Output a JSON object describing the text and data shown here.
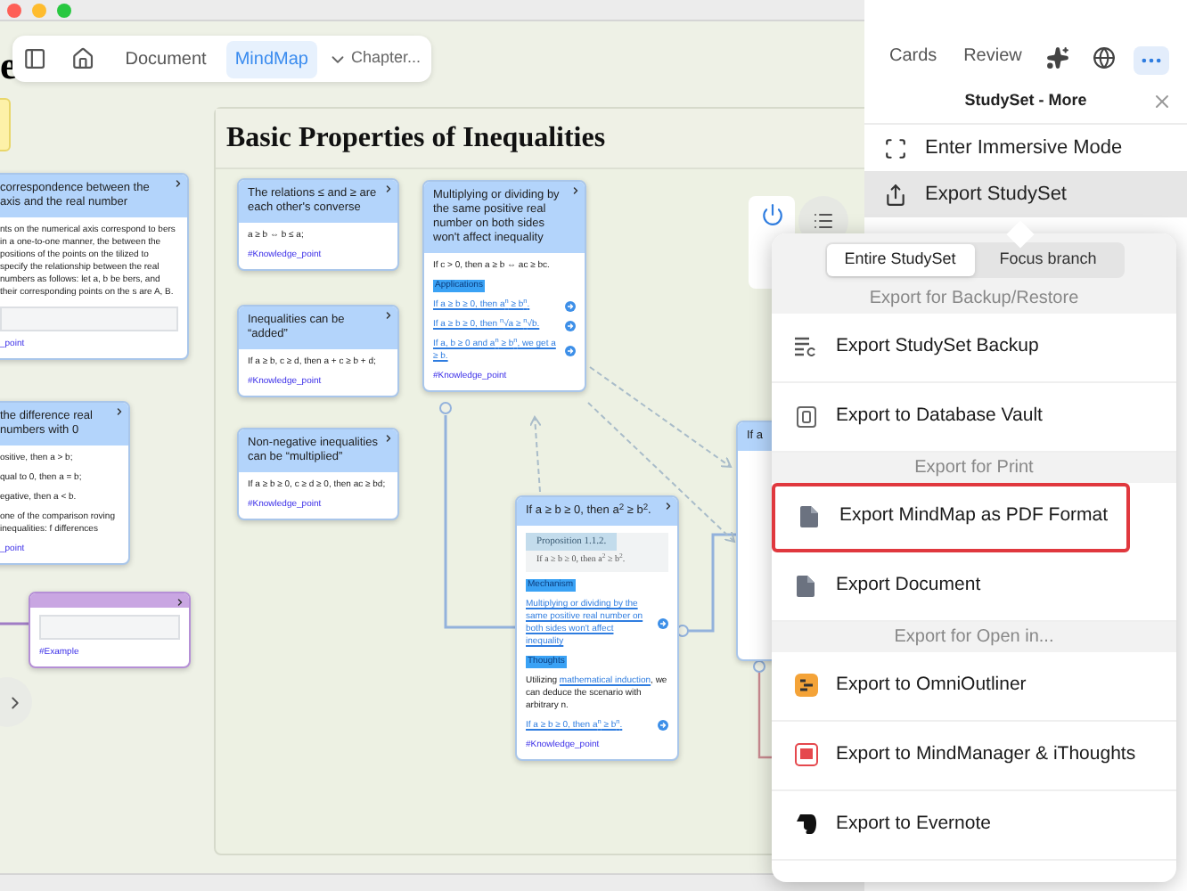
{
  "window": {
    "title_fragment": "e"
  },
  "toolbar": {
    "views": [
      {
        "label": "Document",
        "selected": false
      },
      {
        "label": "MindMap",
        "selected": true
      }
    ],
    "chapter": "Chapter..."
  },
  "canvas": {
    "frame": {
      "title": "Basic Properties of Inequalities"
    },
    "cards": [
      {
        "kind": "note",
        "color": "#fdf1a8"
      },
      {
        "kind": "topic",
        "color": "#b3d4fb",
        "header": "correspondence between the axis and the real number",
        "blocks": [
          {
            "kind": "text",
            "text": "nts on the numerical axis correspond to bers in a one-to-one manner, the between the positions of the points on the tilized to specify the relationship between the real numbers as follows: let a, b be bers, and their corresponding points on the s are A, B."
          },
          {
            "kind": "image"
          },
          {
            "kind": "tag",
            "text": "_point"
          }
        ]
      },
      {
        "kind": "topic",
        "color": "#b3d4fb",
        "header": "the difference real numbers with 0",
        "blocks": [
          {
            "kind": "text",
            "text": "ositive, then a > b;"
          },
          {
            "kind": "text",
            "text": "qual to 0, then a = b;"
          },
          {
            "kind": "text",
            "text": "egative, then a < b."
          },
          {
            "kind": "text",
            "text": "one of the comparison roving inequalities: f differences"
          },
          {
            "kind": "tag",
            "text": "_point"
          }
        ]
      },
      {
        "kind": "example",
        "color": "#c9a6e2",
        "blocks": [
          {
            "kind": "image"
          },
          {
            "kind": "tag",
            "text": "#Example"
          }
        ]
      },
      {
        "kind": "topic",
        "color": "#b3d4fb",
        "header": "The relations ≤ and ≥ are each other's converse",
        "blocks": [
          {
            "kind": "text",
            "text": "a ≥ b ⇔ b ≤ a;"
          },
          {
            "kind": "tag",
            "text": "#Knowledge_point"
          }
        ]
      },
      {
        "kind": "topic",
        "color": "#b3d4fb",
        "header": "Inequalities can be “added”",
        "blocks": [
          {
            "kind": "text",
            "text": "If a ≥ b, c ≥ d, then a + c ≥ b + d;"
          },
          {
            "kind": "tag",
            "text": "#Knowledge_point"
          }
        ]
      },
      {
        "kind": "topic",
        "color": "#b3d4fb",
        "header": "Non-negative inequalities can be “multiplied”",
        "blocks": [
          {
            "kind": "text",
            "text": "If a ≥ b ≥ 0, c ≥ d ≥ 0, then ac ≥ bd;"
          },
          {
            "kind": "tag",
            "text": "#Knowledge_point"
          }
        ]
      },
      {
        "kind": "topic",
        "color": "#b3d4fb",
        "header": "Multiplying or dividing by the same positive real number on both sides won't affect inequality",
        "blocks": [
          {
            "kind": "text",
            "text": "If c > 0, then a ≥ b ⇔ ac ≥ bc."
          },
          {
            "kind": "label",
            "text": "Applications"
          },
          {
            "kind": "link",
            "text": "If a ≥ b ≥ 0, then a$^{n}$ ≥ b$^{n}$.",
            "action": true
          },
          {
            "kind": "link",
            "text": "If a ≥ b ≥ 0, then $^{n}$√a ≥ $^{n}$√b.",
            "action": true
          },
          {
            "kind": "link",
            "text": "If a, b ≥ 0 and a$^{n}$ ≥ b$^{n}$, we get a ≥ b.",
            "action": true
          },
          {
            "kind": "tag",
            "text": "#Knowledge_point"
          }
        ]
      },
      {
        "kind": "topic",
        "color": "#b3d4fb",
        "header": "If a ≥ b ≥ 0, then a$^{2}$ ≥ b$^{2}$.",
        "blocks": [
          {
            "kind": "figure",
            "title": "Proposition 1.1.2.",
            "text": "If a ≥ b ≥ 0, then a$^{2}$ ≥ b$^{2}$."
          },
          {
            "kind": "label",
            "text": "Mechanism"
          },
          {
            "kind": "link",
            "text": "Multiplying or dividing by the same positive real number on both sides won't affect inequality",
            "action": true
          },
          {
            "kind": "label",
            "text": "Thoughts"
          },
          {
            "kind": "sentence",
            "parts": [
              {
                "text": "Utilizing ",
                "link": false
              },
              {
                "text": "mathematical induction",
                "link": true
              },
              {
                "text": ", we can deduce the scenario with arbitrary n.",
                "link": false
              }
            ]
          },
          {
            "kind": "link",
            "text": "If a ≥ b ≥ 0, then a$^{n}$ ≥ b$^{n}$.",
            "action": true
          },
          {
            "kind": "tag",
            "text": "#Knowledge_point"
          }
        ]
      },
      {
        "kind": "topic",
        "color": "#b3d4fb",
        "header": "If a"
      }
    ]
  },
  "panel": {
    "tools": [
      {
        "kind": "text",
        "label": "Cards",
        "selected": false
      },
      {
        "kind": "text",
        "label": "Review",
        "selected": false
      },
      {
        "kind": "sparkle",
        "selected": false
      },
      {
        "kind": "globe",
        "selected": false
      },
      {
        "kind": "more",
        "selected": true
      }
    ],
    "title": "StudySet - More",
    "items": [
      {
        "kind": "immersive",
        "label": "Enter Immersive Mode",
        "selected": false
      },
      {
        "kind": "export",
        "label": "Export StudySet",
        "selected": true
      }
    ]
  },
  "export_menu": {
    "scope": [
      {
        "label": "Entire StudySet",
        "selected": true
      },
      {
        "label": "Focus branch",
        "selected": false
      }
    ],
    "sections": [
      {
        "title": "Export for Backup/Restore",
        "items": [
          {
            "kind": "backup",
            "label": "Export StudySet Backup",
            "highlighted": false
          },
          {
            "kind": "vault",
            "label": "Export to Database Vault",
            "highlighted": false
          }
        ]
      },
      {
        "title": "Export for Print",
        "items": [
          {
            "kind": "pdf",
            "label": "Export MindMap as PDF Format",
            "highlighted": true
          },
          {
            "kind": "pdf",
            "label": "Export Document",
            "highlighted": false
          }
        ]
      },
      {
        "title": "Export for Open in...",
        "items": [
          {
            "kind": "outliner",
            "label": "Export to OmniOutliner",
            "highlighted": false
          },
          {
            "kind": "mindmanager",
            "label": "Export to MindManager & iThoughts",
            "highlighted": false
          },
          {
            "kind": "evernote",
            "label": "Export to Evernote",
            "highlighted": false
          }
        ]
      }
    ]
  }
}
